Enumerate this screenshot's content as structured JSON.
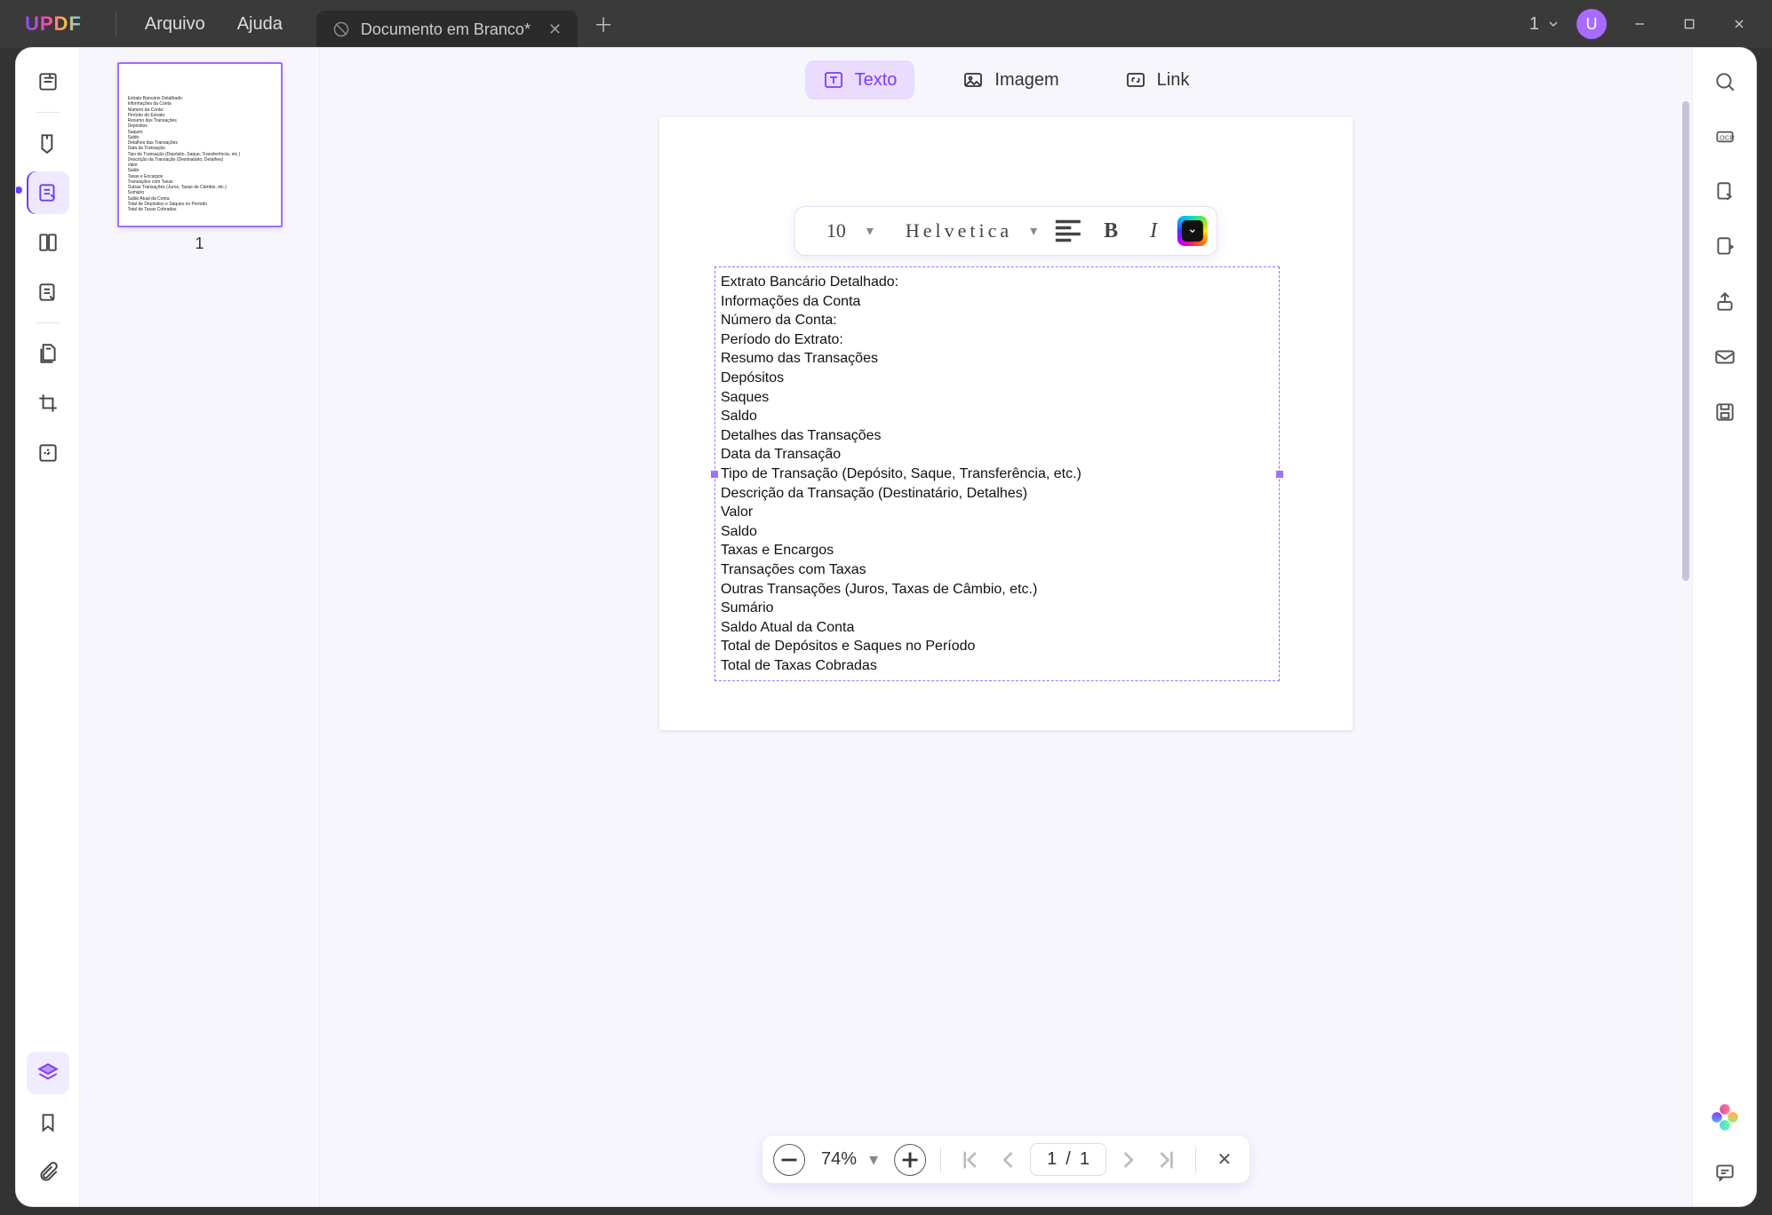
{
  "app": {
    "logo": "UPDF"
  },
  "menu": {
    "file": "Arquivo",
    "help": "Ajuda"
  },
  "tab": {
    "title": "Documento em Branco*"
  },
  "titleDropdown": {
    "value": "1"
  },
  "avatar": {
    "initial": "U"
  },
  "modes": {
    "text": "Texto",
    "image": "Imagem",
    "link": "Link"
  },
  "format": {
    "size": "10",
    "font": "Helvetica"
  },
  "doc": {
    "lines": [
      "Extrato Bancário Detalhado:",
      "Informações da Conta",
      "Número da Conta:",
      "Período do Extrato:",
      "Resumo das Transações",
      "Depósitos",
      "Saques",
      "Saldo",
      "Detalhes das Transações",
      "Data da Transação",
      "Tipo de Transação (Depósito, Saque, Transferência, etc.)",
      "Descrição da Transação (Destinatário, Detalhes)",
      "Valor",
      "Saldo",
      "Taxas e Encargos",
      "Transações com Taxas",
      "Outras Transações (Juros, Taxas de Câmbio, etc.)",
      "Sumário",
      "Saldo Atual da Conta",
      "Total de Depósitos e Saques no Período",
      "Total de Taxas Cobradas"
    ]
  },
  "thumbnail": {
    "page_label": "1"
  },
  "zoom": {
    "percent": "74%",
    "page_current": "1",
    "page_sep": "/",
    "page_total": "1"
  }
}
